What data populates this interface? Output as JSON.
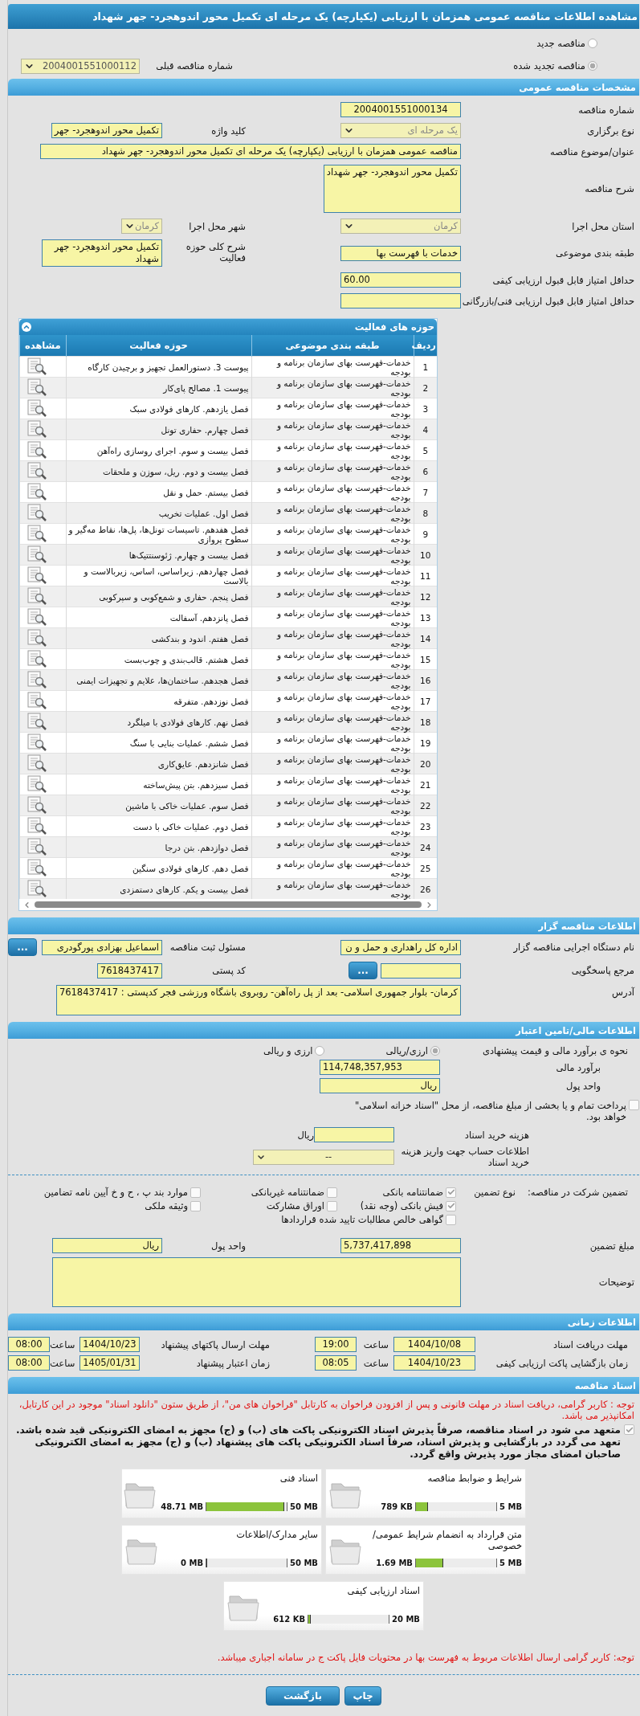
{
  "page_title": "مشاهده اطلاعات مناقصه عمومی همزمان با ارزیابی (یکپارچه) یک مرحله ای تکمیل محور اندوهجرد- جهر شهداد",
  "tender_mode": [
    {
      "label": "مناقصه جدید",
      "selected": false
    },
    {
      "label": "مناقصه تجدید شده",
      "selected": true
    }
  ],
  "previous_tender": {
    "label": "شماره مناقصه قبلی",
    "value": "2004001551000112"
  },
  "general": {
    "title": "مشخصات مناقصه عمومی",
    "rows": [
      [
        {
          "kind": "code",
          "label": "شماره مناقصه",
          "value": "2004001551000134"
        }
      ],
      [
        {
          "kind": "select",
          "label": "نوع برگزاری",
          "value": "یک مرحله ای"
        },
        {
          "kind": "input",
          "label": "کلید واژه",
          "value": "تکمیل محور اندوهجرد- جهر"
        }
      ],
      [
        {
          "kind": "wide",
          "label": "عنوان/موضوع مناقصه",
          "value": "مناقصه عمومی همزمان با ارزیابی (یکپارچه) یک مرحله ای تکمیل محور اندوهجرد- جهر شهداد"
        }
      ],
      [
        {
          "kind": "textarea",
          "label": "شرح مناقصه",
          "value": "تکمیل محور اندوهجرد- جهر شهداد"
        }
      ],
      [
        {
          "kind": "select",
          "label": "استان محل اجرا",
          "value": "کرمان"
        },
        {
          "kind": "select",
          "label": "شهر محل اجرا",
          "value": "کرمان"
        }
      ],
      [
        {
          "kind": "input",
          "label": "طبقه بندی موضوعی",
          "value": "خدمات با فهرست بها"
        },
        {
          "kind": "memo",
          "label": "شرح کلی حوزه فعالیت",
          "value": "تکمیل محور اندوهجرد- جهر شهداد"
        }
      ],
      [
        {
          "kind": "number",
          "label": "حداقل امتیاز قابل قبول ارزیابی کیفی",
          "value": "60.00"
        }
      ],
      [
        {
          "kind": "input",
          "label": "حداقل امتیاز قابل قبول ارزیابی فنی/بازرگانی"
        }
      ]
    ]
  },
  "activities": {
    "title": "حوزه های فعالیت",
    "columns": [
      "ردیف",
      "طبقه بندی موضوعی",
      "حوزه فعالیت",
      "مشاهده"
    ],
    "rows": [
      {
        "row": "1",
        "category": "خدمات-فهرست بهای سازمان برنامه و بودجه",
        "activity": "پیوست 3. دستورالعمل تجهیز و برچیدن کارگاه"
      },
      {
        "row": "2",
        "category": "خدمات-فهرست بهای سازمان برنامه و بودجه",
        "activity": "پیوست 1. مصالح پای‌کار"
      },
      {
        "row": "3",
        "category": "خدمات-فهرست بهای سازمان برنامه و بودجه",
        "activity": "فصل یازدهم. کارهای فولادی سبک"
      },
      {
        "row": "4",
        "category": "خدمات-فهرست بهای سازمان برنامه و بودجه",
        "activity": "فصل چهارم. حفاری تونل"
      },
      {
        "row": "5",
        "category": "خدمات-فهرست بهای سازمان برنامه و بودجه",
        "activity": "فصل بیست و سوم. اجرای روسازی راه‌آهن"
      },
      {
        "row": "6",
        "category": "خدمات-فهرست بهای سازمان برنامه و بودجه",
        "activity": "فصل بیست و دوم. ریل، سوزن و ملحقات"
      },
      {
        "row": "7",
        "category": "خدمات-فهرست بهای سازمان برنامه و بودجه",
        "activity": "فصل بیستم. حمل و نقل"
      },
      {
        "row": "8",
        "category": "خدمات-فهرست بهای سازمان برنامه و بودجه",
        "activity": "فصل اول. عملیات تخریب"
      },
      {
        "row": "9",
        "category": "خدمات-فهرست بهای سازمان برنامه و بودجه",
        "activity": "فصل هفدهم. تاسیسات تونل‌ها، پل‌ها، نقاط مه‌گیر و سطوح پروازی"
      },
      {
        "row": "10",
        "category": "خدمات-فهرست بهای سازمان برنامه و بودجه",
        "activity": "فصل بیست و چهارم. ژئوسنتتیک‌ها"
      },
      {
        "row": "11",
        "category": "خدمات-فهرست بهای سازمان برنامه و بودجه",
        "activity": "فصل چهاردهم. زیراساس، اساس، زیربالاست و بالاست"
      },
      {
        "row": "12",
        "category": "خدمات-فهرست بهای سازمان برنامه و بودجه",
        "activity": "فصل پنجم. حفاری و شمع‌کوبی و سپرکوبی"
      },
      {
        "row": "13",
        "category": "خدمات-فهرست بهای سازمان برنامه و بودجه",
        "activity": "فصل پانزدهم. آسفالت"
      },
      {
        "row": "14",
        "category": "خدمات-فهرست بهای سازمان برنامه و بودجه",
        "activity": "فصل هفتم. اندود و بندکشی"
      },
      {
        "row": "15",
        "category": "خدمات-فهرست بهای سازمان برنامه و بودجه",
        "activity": "فصل هشتم. قالب‌بندی و چوب‌بست"
      },
      {
        "row": "16",
        "category": "خدمات-فهرست بهای سازمان برنامه و بودجه",
        "activity": "فصل هجدهم. ساختمان‌ها، علایم و تجهیزات ایمنی"
      },
      {
        "row": "17",
        "category": "خدمات-فهرست بهای سازمان برنامه و بودجه",
        "activity": "فصل نوزدهم. متفرقه"
      },
      {
        "row": "18",
        "category": "خدمات-فهرست بهای سازمان برنامه و بودجه",
        "activity": "فصل نهم. کارهای فولادی با میلگرد"
      },
      {
        "row": "19",
        "category": "خدمات-فهرست بهای سازمان برنامه و بودجه",
        "activity": "فصل ششم. عملیات بنایی با سنگ"
      },
      {
        "row": "20",
        "category": "خدمات-فهرست بهای سازمان برنامه و بودجه",
        "activity": "فصل شانزدهم. عایق‌کاری"
      },
      {
        "row": "21",
        "category": "خدمات-فهرست بهای سازمان برنامه و بودجه",
        "activity": "فصل سیزدهم. بتن پیش‌ساخته"
      },
      {
        "row": "22",
        "category": "خدمات-فهرست بهای سازمان برنامه و بودجه",
        "activity": "فصل سوم. عملیات خاکی با ماشین"
      },
      {
        "row": "23",
        "category": "خدمات-فهرست بهای سازمان برنامه و بودجه",
        "activity": "فصل دوم. عملیات خاکی با دست"
      },
      {
        "row": "24",
        "category": "خدمات-فهرست بهای سازمان برنامه و بودجه",
        "activity": "فصل دوازدهم. بتن درجا"
      },
      {
        "row": "25",
        "category": "خدمات-فهرست بهای سازمان برنامه و بودجه",
        "activity": "فصل دهم. کارهای فولادی سنگین"
      },
      {
        "row": "26",
        "category": "خدمات-فهرست بهای سازمان برنامه و بودجه",
        "activity": "فصل بیست و یکم. کارهای دستمزدی"
      }
    ]
  },
  "organizer": {
    "title": "اطلاعات مناقصه گزار",
    "rows": [
      [
        {
          "kind": "input",
          "label": "نام دستگاه اجرایی مناقصه گزار",
          "value": "اداره کل راهداری و حمل و ن"
        },
        {
          "kind": "input",
          "label": "مسئول ثبت مناقصه",
          "value": "اسماعیل بهزادی پورگودری",
          "button": "..."
        }
      ],
      [
        {
          "kind": "input",
          "label": "مرجع پاسخگویی",
          "button": "..."
        },
        {
          "kind": "number",
          "label": "کد پستی",
          "value": "7618437417"
        }
      ],
      [
        {
          "kind": "address",
          "label": "آدرس",
          "value": "کرمان- بلوار جمهوری اسلامی- بعد از پل راه‌آهن- روبروی باشگاه ورزشی فجر  کدپستی : 7618437417"
        }
      ]
    ]
  },
  "finance": {
    "title": "اطلاعات مالی/تامین اعتبار",
    "pricing": {
      "label": "نحوه ی برآورد مالی و قیمت پیشنهادی",
      "options": [
        {
          "label": "ارزی/ریالی",
          "selected": true
        },
        {
          "label": "ارزی و ریالی",
          "selected": false
        }
      ]
    },
    "estimate": {
      "label": "برآورد مالی",
      "value": "114,748,357,953"
    },
    "currency": {
      "label": "واحد پول",
      "value": "ریال"
    },
    "treasury": {
      "label": "پرداخت تمام و یا بخشی از مبلغ مناقصه، از محل \"اسناد خزانه اسلامی\" خواهد بود.",
      "checked": false
    },
    "doc_cost": {
      "label": "هزینه خرید اسناد",
      "unit": "ریال"
    },
    "account": {
      "label": "اطلاعات حساب جهت واریز هزینه خرید اسناد",
      "value": "--"
    }
  },
  "guarantee": {
    "label": "تضمین شرکت در مناقصه:",
    "type_label": "نوع تضمین",
    "options": [
      {
        "label": "ضمانتنامه بانکی",
        "checked": true
      },
      {
        "label": "ضمانتنامه غیربانکی",
        "checked": false
      },
      {
        "label": "موارد بند پ ، ح و خ آیین نامه تضامین",
        "checked": false
      },
      {
        "label": "فیش بانکی (وجه نقد)",
        "checked": true
      },
      {
        "label": "اوراق مشارکت",
        "checked": false
      },
      {
        "label": "وثیقه ملکی",
        "checked": false
      },
      {
        "label": "گواهی خالص مطالبات تایید شده قراردادها",
        "checked": false
      }
    ],
    "amount": {
      "label": "مبلغ تضمین",
      "value": "5,737,417,898"
    },
    "currency": {
      "label": "واحد پول",
      "value": "ریال"
    },
    "notes": {
      "label": "توضیحات"
    }
  },
  "timing": {
    "title": "اطلاعات زمانی",
    "rows": [
      [
        {
          "label": "مهلت دریافت اسناد",
          "date": "1404/10/08",
          "time_label": "ساعت",
          "time": "19:00"
        },
        {
          "label": "مهلت ارسال پاکتهای پیشنهاد",
          "date": "1404/10/23",
          "time_label": "ساعت",
          "time": "08:00"
        }
      ],
      [
        {
          "label": "زمان بازگشایی پاکت ارزیابی کیفی",
          "date": "1404/10/23",
          "time_label": "ساعت",
          "time": "08:05"
        },
        {
          "label": "زمان اعتبار پیشنهاد",
          "date": "1405/01/31",
          "time_label": "ساعت",
          "time": "08:00"
        }
      ]
    ]
  },
  "documents": {
    "title": "اسناد مناقصه",
    "notice": "توجه : کاربر گرامی، دریافت اسناد در مهلت قانونی و پس از افزودن فراخوان به کارتابل \"فراخوان های من\"، از طریق ستون \"دانلود اسناد\" موجود در این کارتابل، امکانپذیر می باشد.",
    "commitment": {
      "text": "متعهد می شود در اسناد مناقصه، صرفاً پذیرش اسناد الکترونیکی پاکت های (ب) و (ج) مجهز به امضای الکترونیکی قید شده باشد. تعهد می گردد در بازگشایی و پذیرش اسناد، صرفاً اسناد الکترونیکی پاکت های پیشنهاد (ب) و (ج) مجهز به امضای الکترونیکی صاحبان امضای مجاز مورد پذیرش واقع گردد.",
      "checked": true
    },
    "files": [
      {
        "title": "شرایط و ضوابط مناقصه",
        "used": "789 KB",
        "max": "5 MB",
        "level": 0.154
      },
      {
        "title": "اسناد فنی",
        "used": "48.71 MB",
        "max": "50 MB",
        "level": 0.974
      },
      {
        "title": "متن قرارداد به انضمام شرایط عمومی/خصوصی",
        "used": "1.69 MB",
        "max": "5 MB",
        "level": 0.338
      },
      {
        "title": "سایر مدارک/اطلاعات",
        "used": "0 MB",
        "max": "50 MB",
        "level": 0
      },
      {
        "title": "اسناد ارزیابی کیفی",
        "used": "612 KB",
        "max": "20 MB",
        "level": 0.03
      }
    ],
    "footer_note": "توجه: کاربر گرامی ارسال اطلاعات مربوط به فهرست بها در محتویات فایل پاکت ج در سامانه اجباری میباشد."
  },
  "actions": [
    "چاپ",
    "بازگشت"
  ]
}
